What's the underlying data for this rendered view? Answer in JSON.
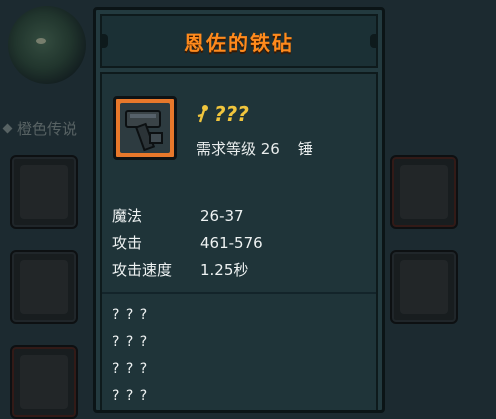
{
  "background": {
    "section_header": "橙色传说"
  },
  "tooltip": {
    "title": "恩佐的铁砧",
    "item_icon": "anvil-hammer-icon",
    "name_icon": "key-glyph-icon",
    "item_name": "???",
    "requirement": "需求等级 26",
    "weapon_type": "锤",
    "stats": [
      {
        "label": "魔法",
        "value": "26-37"
      },
      {
        "label": "攻击",
        "value": "461-576"
      },
      {
        "label": "攻击速度",
        "value": "1.25秒"
      }
    ],
    "hidden_lines": [
      "? ? ?",
      "? ? ?",
      "? ? ?",
      "? ? ?"
    ],
    "colors": {
      "title": "#ff8a1c",
      "item_name": "#f0c53d",
      "icon_frame": "#e8782b",
      "panel": "#233a3f"
    }
  }
}
